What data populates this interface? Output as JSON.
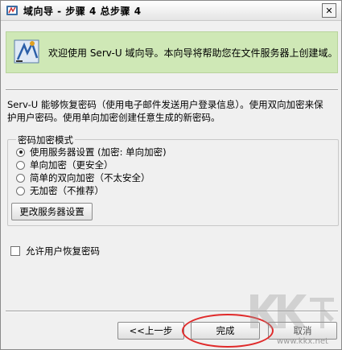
{
  "window": {
    "title": "域向导 - 步骤 4 总步骤 4",
    "close_symbol": "✕"
  },
  "banner": {
    "icon": "wizard-icon",
    "text": "欢迎使用 Serv-U 域向导。本向导将帮助您在文件服务器上创建域。"
  },
  "description": {
    "line1": "Serv-U 能够恢复密码（使用电子邮件发送用户登录信息）。使用双向加密来保",
    "line2": "护用户密码。使用单向加密创建任意生成的新密码。"
  },
  "encryption_group": {
    "label": "密码加密模式",
    "options": [
      {
        "label": "使用服务器设置 (加密: 单向加密)",
        "checked": true
      },
      {
        "label": "单向加密（更安全）",
        "checked": false
      },
      {
        "label": "简单的双向加密（不太安全）",
        "checked": false
      },
      {
        "label": "无加密（不推荐）",
        "checked": false
      }
    ],
    "change_server_settings_label": "更改服务器设置"
  },
  "allow_recover": {
    "label": "允许用户恢复密码",
    "checked": false
  },
  "footer": {
    "back_label": "<<上一步",
    "finish_label": "完成",
    "cancel_label": "取消"
  },
  "watermark": {
    "logo_text": "KK下载",
    "url": "www.kkx.net"
  },
  "colors": {
    "banner_bg": "#cfe8b6",
    "highlight_ellipse": "#e02a2a"
  }
}
